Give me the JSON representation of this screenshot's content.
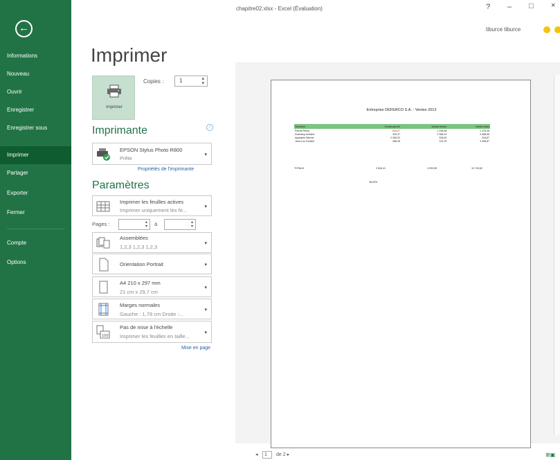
{
  "window": {
    "title": "chapitre02.xlsx - Excel (Évaluation)",
    "help": "?",
    "minimize": "–",
    "maximize": "□",
    "close": "×",
    "user": "tiburce tiburce"
  },
  "sidebar": {
    "back_icon": "arrow-left-circle-icon",
    "items": [
      {
        "label": "Informations"
      },
      {
        "label": "Nouveau"
      },
      {
        "label": "Ouvrir"
      },
      {
        "label": "Enregistrer"
      },
      {
        "label": "Enregistrer sous"
      },
      {
        "label": "Imprimer"
      },
      {
        "label": "Partager"
      },
      {
        "label": "Exporter"
      },
      {
        "label": "Fermer"
      },
      {
        "label": "Compte"
      },
      {
        "label": "Options"
      }
    ],
    "active": "Imprimer",
    "colors": {
      "background": "#217346",
      "active": "#0e5c2f"
    }
  },
  "print": {
    "heading": "Imprimer",
    "print_button": "Imprimer",
    "copies_label": "Copies :",
    "copies_value": "1",
    "printer_section": "Imprimante",
    "printer": {
      "name": "EPSON Stylus Photo R800",
      "status": "Prête"
    },
    "printer_properties": "Propriétés de l'imprimante",
    "settings_section": "Paramètres",
    "what_to_print": {
      "line1": "Imprimer les feuilles actives",
      "line2": "Imprimer uniquement les fe..."
    },
    "pages_label": "Pages :",
    "pages_to_label": "à",
    "collate": {
      "line1": "Assemblées",
      "line2": "1,2,3   1,2,3   1,2,3"
    },
    "orientation": {
      "line1": "Orientation Portrait"
    },
    "paper": {
      "line1": "A4 210 x 297 mm",
      "line2": "21 cm x 29,7 cm"
    },
    "margins": {
      "line1": "Marges normales",
      "line2": "Gauche : 1,78 cm   Droite :..."
    },
    "scaling": {
      "line1": "Pas de mise à l'échelle",
      "line2": "Imprimer les feuilles en taille..."
    },
    "page_setup": "Mise en page"
  },
  "preview": {
    "doc_title": "Entreprise DEFERCO S.A. - Ventes 2013",
    "headers": [
      "Vendeurs",
      "Ventes janvier",
      "Ventes février",
      "Ventes mars"
    ],
    "rows": [
      [
        "Petras Rémy",
        "835,67",
        "1 236,48",
        "1 478,26"
      ],
      [
        "Duchamp Antoine",
        "325,37",
        "2 368,24",
        "3 488,55"
      ],
      [
        "Aquitaine Werner",
        "2 365,02",
        "328,52",
        "318,87"
      ],
      [
        "Jean-Luc Godard",
        "288,45",
        "123,76",
        "3 458,87"
      ]
    ],
    "total": [
      "TOTAUX",
      "2 844,41",
      "4 093,55",
      "10 743,62"
    ],
    "percent": "38,53%",
    "page_current": "1",
    "page_total": "de 2 ▸",
    "prev": "◂"
  }
}
